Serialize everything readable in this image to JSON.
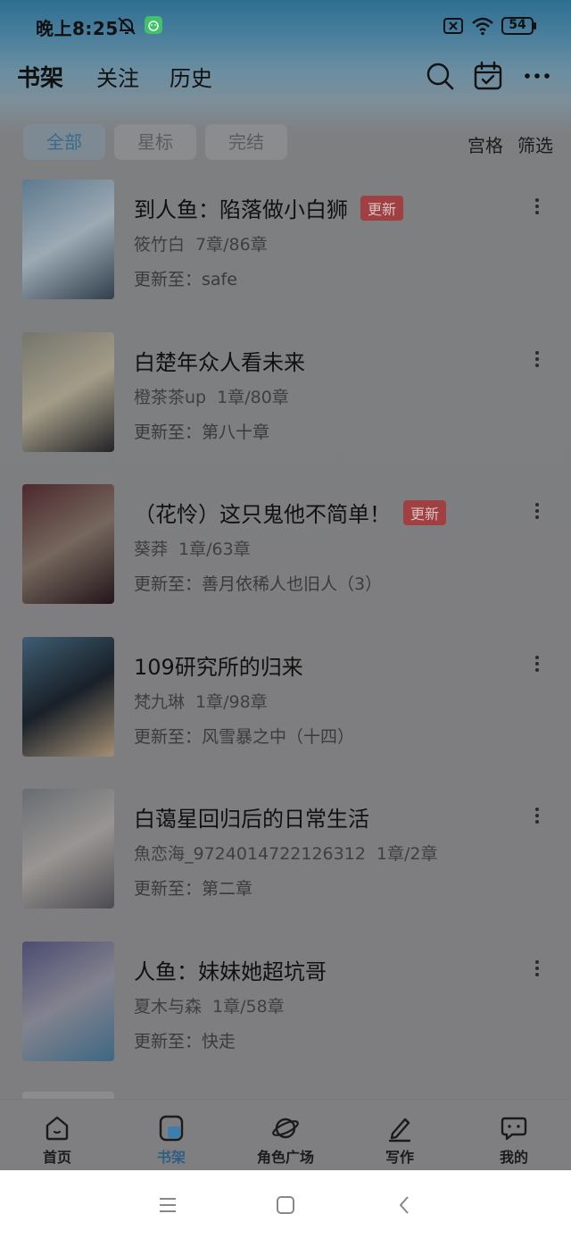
{
  "status_bar": {
    "time": "晚上8:25",
    "battery": "54"
  },
  "top_nav": {
    "tabs": [
      "书架",
      "关注",
      "历史"
    ],
    "active_tab": "书架"
  },
  "filters": {
    "chips": [
      "全部",
      "星标",
      "完结"
    ],
    "active": "全部",
    "view_mode": "宫格",
    "filter_label": "筛选"
  },
  "books": [
    {
      "title": "到人鱼：陷落做小白狮",
      "badge": "更新",
      "author": "筱竹白",
      "progress": "7章/86章",
      "update": "更新至：safe",
      "cover_colors": [
        "#6f8fa8",
        "#b8c8d4",
        "#3a4a5a"
      ]
    },
    {
      "title": "白楚年众人看未来",
      "badge": "",
      "author": "橙茶茶up",
      "progress": "1章/80章",
      "update": "更新至：第八十章",
      "cover_colors": [
        "#8a8a80",
        "#c0b8a0",
        "#2a2a2e"
      ]
    },
    {
      "title": "（花怜）这只鬼他不简单！",
      "badge": "更新",
      "author": "葵莽",
      "progress": "1章/63章",
      "update": "更新至：善月依稀人也旧人（3）",
      "cover_colors": [
        "#5a3036",
        "#8a7a6e",
        "#2a1a20"
      ]
    },
    {
      "title": "109研究所的归来",
      "badge": "",
      "author": "梵九琳",
      "progress": "1章/98章",
      "update": "更新至：风雪暴之中（十四）",
      "cover_colors": [
        "#4a6e86",
        "#1e2630",
        "#c0a888"
      ]
    },
    {
      "title": "白蔼星回归后的日常生活",
      "badge": "",
      "author": "魚恋海_9724014722126312",
      "progress": "1章/2章",
      "update": "更新至：第二章",
      "cover_colors": [
        "#7a8088",
        "#b4b0ac",
        "#5a5860"
      ]
    },
    {
      "title": "人鱼：妹妹她超坑哥",
      "badge": "",
      "author": "夏木与森",
      "progress": "1章/58章",
      "update": "更新至：快走",
      "cover_colors": [
        "#5a5a86",
        "#9a9aa8",
        "#4a7a9a"
      ]
    }
  ],
  "bottom_tabs": [
    {
      "label": "首页",
      "icon": "home-icon"
    },
    {
      "label": "书架",
      "icon": "bookshelf-icon"
    },
    {
      "label": "角色广场",
      "icon": "planet-icon"
    },
    {
      "label": "写作",
      "icon": "pen-icon"
    },
    {
      "label": "我的",
      "icon": "chat-bubble-icon"
    }
  ],
  "active_bottom_tab": "书架"
}
